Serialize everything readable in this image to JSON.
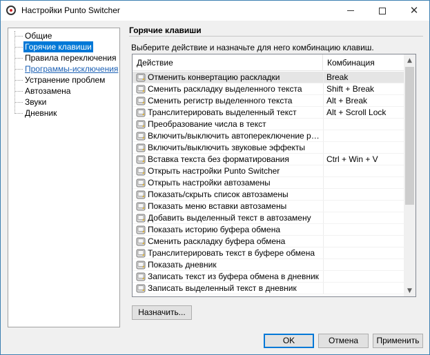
{
  "window": {
    "title": "Настройки Punto Switcher"
  },
  "nav": {
    "items": [
      {
        "label": "Общие",
        "state": "normal"
      },
      {
        "label": "Горячие клавиши",
        "state": "selected"
      },
      {
        "label": "Правила переключения",
        "state": "normal"
      },
      {
        "label": "Программы-исключения",
        "state": "link"
      },
      {
        "label": "Устранение проблем",
        "state": "normal"
      },
      {
        "label": "Автозамена",
        "state": "normal"
      },
      {
        "label": "Звуки",
        "state": "normal"
      },
      {
        "label": "Дневник",
        "state": "normal"
      }
    ]
  },
  "panel": {
    "title": "Горячие клавиши",
    "instruction": "Выберите действие и назначьте для него комбинацию клавиш."
  },
  "table": {
    "columns": {
      "action": "Действие",
      "combination": "Комбинация"
    },
    "rows": [
      {
        "action": "Отменить конвертацию раскладки",
        "combination": "Break"
      },
      {
        "action": "Сменить раскладку выделенного текста",
        "combination": "Shift + Break"
      },
      {
        "action": "Сменить регистр выделенного текста",
        "combination": "Alt + Break"
      },
      {
        "action": "Транслитерировать выделенный текст",
        "combination": "Alt + Scroll Lock"
      },
      {
        "action": "Преобразование числа в текст",
        "combination": ""
      },
      {
        "action": "Включить/выключить автопереключение рас...",
        "combination": ""
      },
      {
        "action": "Включить/выключить звуковые эффекты",
        "combination": ""
      },
      {
        "action": "Вставка текста без форматирования",
        "combination": "Ctrl + Win + V"
      },
      {
        "action": "Открыть настройки Punto Switcher",
        "combination": ""
      },
      {
        "action": "Открыть настройки автозамены",
        "combination": ""
      },
      {
        "action": "Показать/скрыть список автозамены",
        "combination": ""
      },
      {
        "action": "Показать меню вставки автозамены",
        "combination": ""
      },
      {
        "action": "Добавить выделенный текст в автозамену",
        "combination": ""
      },
      {
        "action": "Показать историю буфера обмена",
        "combination": ""
      },
      {
        "action": "Сменить раскладку буфера обмена",
        "combination": ""
      },
      {
        "action": "Транслитерировать текст в буфере обмена",
        "combination": ""
      },
      {
        "action": "Показать дневник",
        "combination": ""
      },
      {
        "action": "Записать текст из буфера обмена в дневник",
        "combination": ""
      },
      {
        "action": "Записать выделенный текст в дневник",
        "combination": ""
      }
    ],
    "highlighted_row": 0
  },
  "buttons": {
    "assign": "Назначить...",
    "ok": "OK",
    "cancel": "Отмена",
    "apply": "Применить"
  },
  "colors": {
    "selection": "#0078d7",
    "link": "#1a5fb4",
    "window_bg": "#f0f0f0"
  },
  "icons": {
    "app": "punto-switcher-icon",
    "row": "keyboard-key-icon"
  }
}
